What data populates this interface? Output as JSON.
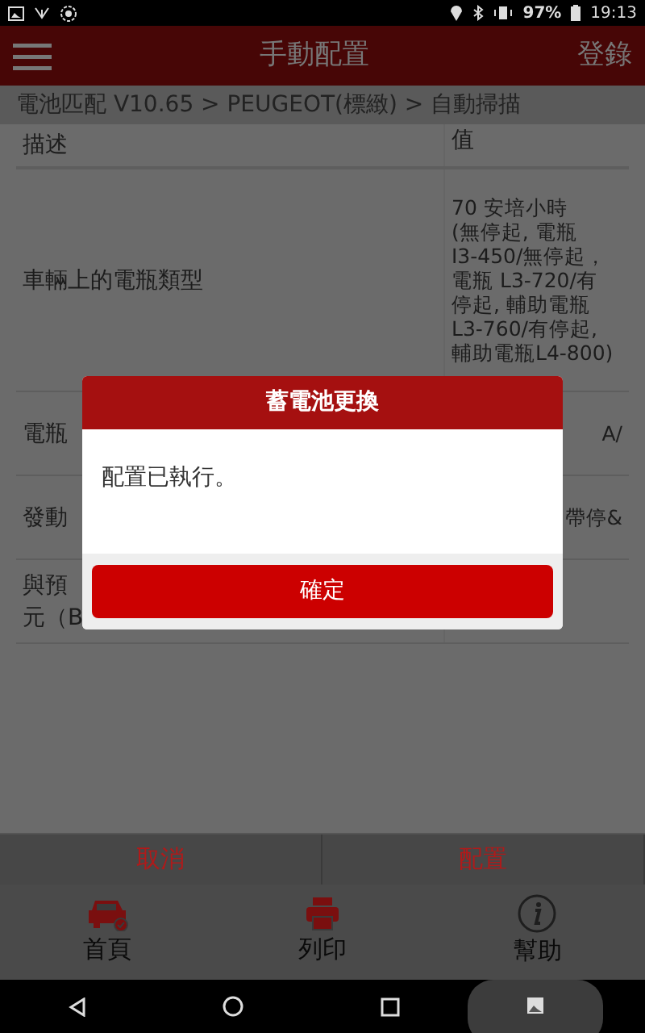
{
  "status_bar": {
    "battery": "97%",
    "time": "19:13"
  },
  "header": {
    "title": "手動配置",
    "action": "登錄"
  },
  "breadcrumb": "電池匹配 V10.65 > PEUGEOT(標緻) > 自動掃描",
  "table": {
    "columns": [
      "描述",
      "值"
    ],
    "rows": [
      {
        "description": [
          "車輛上的電瓶類型"
        ],
        "value": [
          "70 安培小時",
          "(無停起, 電瓶",
          "I3-450/無停起，",
          "電瓶 L3-720/有",
          "停起, 輔助電瓶",
          "L3-760/有停起,",
          "輔助電瓶L4-800)"
        ]
      },
      {
        "description": [
          "電瓶"
        ],
        "value": [
          "A/"
        ]
      },
      {
        "description": [
          "發動"
        ],
        "value": [
          "帶停&"
        ]
      },
      {
        "description": [
          "與預",
          "元（B"
        ],
        "value": []
      }
    ]
  },
  "dialog": {
    "title": "蓄電池更換",
    "message": "配置已執行。",
    "button": "確定"
  },
  "actions": [
    "取消",
    "配置"
  ],
  "tabs": [
    {
      "label": "首頁"
    },
    {
      "label": "列印"
    },
    {
      "label": "幫助"
    }
  ]
}
